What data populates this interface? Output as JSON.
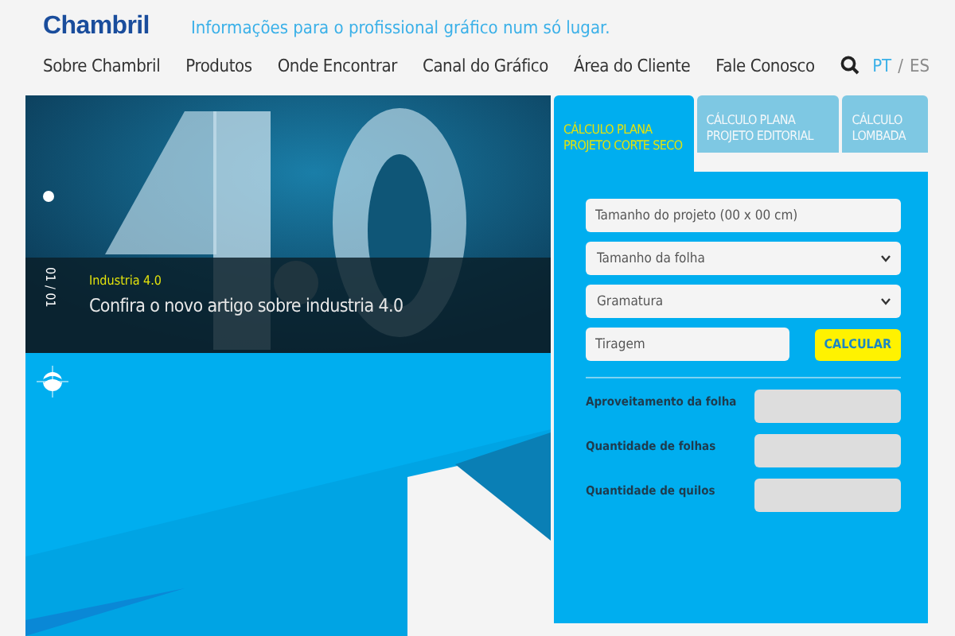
{
  "header": {
    "logo": "Chambril",
    "tagline": "Informações para o profissional gráfico num só lugar."
  },
  "nav": {
    "items": [
      {
        "label": "Sobre Chambril"
      },
      {
        "label": "Produtos"
      },
      {
        "label": "Onde Encontrar"
      },
      {
        "label": "Canal do Gráfico"
      },
      {
        "label": "Área do Cliente"
      },
      {
        "label": "Fale Conosco"
      }
    ],
    "languages": [
      {
        "label": "PT",
        "selected": true
      },
      {
        "label": "ES",
        "selected": false
      }
    ],
    "separator": "/"
  },
  "slider": {
    "counter": "01 / 01",
    "category": "Industria 4.0",
    "headline": "Confira o novo artigo sobre industria 4.0"
  },
  "calculator": {
    "tabs": [
      {
        "label": "CÁLCULO PLANA PROJETO CORTE SECO",
        "selected": true
      },
      {
        "label": "CÁLCULO PLANA PROJETO EDITORIAL",
        "selected": false
      },
      {
        "label": "CÁLCULO LOMBADA",
        "selected": false
      }
    ],
    "fields": [
      {
        "kind": "input",
        "placeholder": "Tamanho do projeto (00 x 00 cm)"
      },
      {
        "kind": "select",
        "value": "Tamanho da folha"
      },
      {
        "kind": "select",
        "value": "Gramatura"
      }
    ],
    "quantity": {
      "placeholder": "Tiragem"
    },
    "button": "CALCULAR",
    "results": [
      {
        "label": "Aproveitamento da folha"
      },
      {
        "label": "Quantidade de folhas"
      },
      {
        "label": "Quantidade de quilos"
      }
    ]
  }
}
